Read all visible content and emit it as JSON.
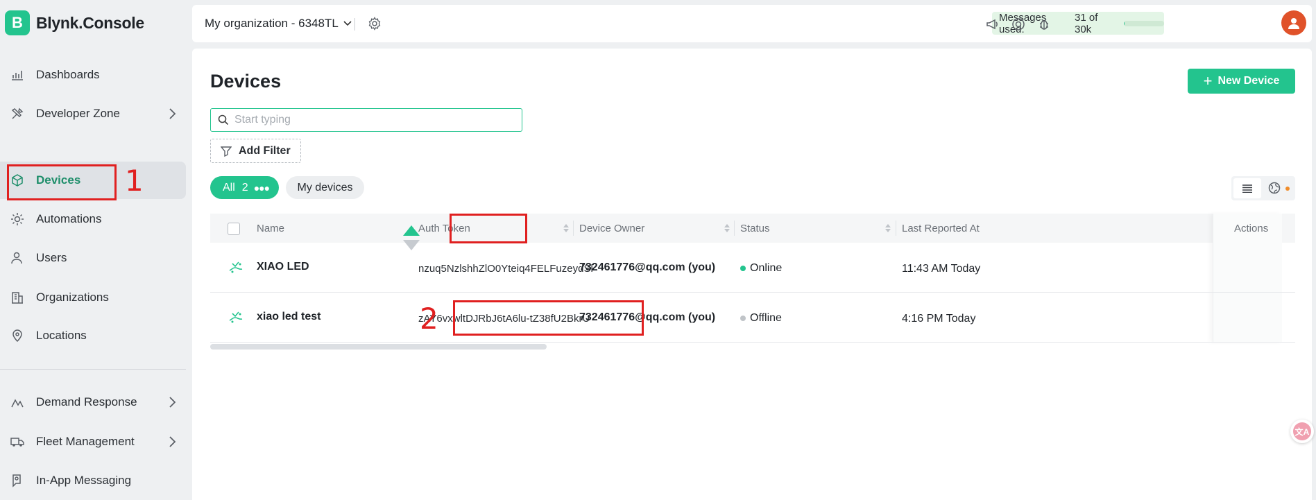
{
  "app": {
    "logo_letter": "B",
    "logo_text": "Blynk.Console"
  },
  "sidebar": {
    "items": [
      {
        "label": "Dashboards",
        "icon": "chart-icon"
      },
      {
        "label": "Developer Zone",
        "icon": "tools-icon",
        "has_chevron": true
      },
      {
        "label": "Devices",
        "icon": "cube-icon",
        "active": true
      },
      {
        "label": "Automations",
        "icon": "automation-icon"
      },
      {
        "label": "Users",
        "icon": "users-icon"
      },
      {
        "label": "Organizations",
        "icon": "building-icon"
      },
      {
        "label": "Locations",
        "icon": "pin-icon"
      },
      {
        "label": "Demand Response",
        "icon": "signal-icon",
        "has_chevron": true
      },
      {
        "label": "Fleet Management",
        "icon": "truck-icon",
        "has_chevron": true
      },
      {
        "label": "In-App Messaging",
        "icon": "message-icon"
      }
    ]
  },
  "topbar": {
    "org_name": "My organization - 6348TL",
    "messages_label": "Messages used:",
    "messages_value": "31 of 30k",
    "messages_fill": 0.001
  },
  "page": {
    "title": "Devices",
    "new_device_label": "New Device",
    "search_placeholder": "Start typing",
    "add_filter_label": "Add Filter",
    "filter_all_label": "All",
    "filter_all_count": "2",
    "filter_my_label": "My devices"
  },
  "table": {
    "columns": [
      "Name",
      "Auth Token",
      "Device Owner",
      "Status",
      "Last Reported At",
      "Actions"
    ],
    "rows": [
      {
        "name": "XIAO LED",
        "token": "nzuq5NzlshhZlO0Yteiq4FELFuzeydSl",
        "owner": "732461776@qq.com (you)",
        "status": "Online",
        "last": "11:43 AM Today"
      },
      {
        "name": "xiao led test",
        "token": "zAY6vxwltDJRbJ6tA6lu-tZ38fU2BkrU",
        "owner": "732461776@qq.com (you)",
        "status": "Offline",
        "last": "4:16 PM Today"
      }
    ]
  },
  "annotations": {
    "n1": "1",
    "n2": "2"
  },
  "colors": {
    "accent": "#23c48e",
    "online": "#23c48e",
    "offline": "#c0c4c8",
    "annotation": "#e02020"
  },
  "float_button": {
    "text": "文A"
  }
}
